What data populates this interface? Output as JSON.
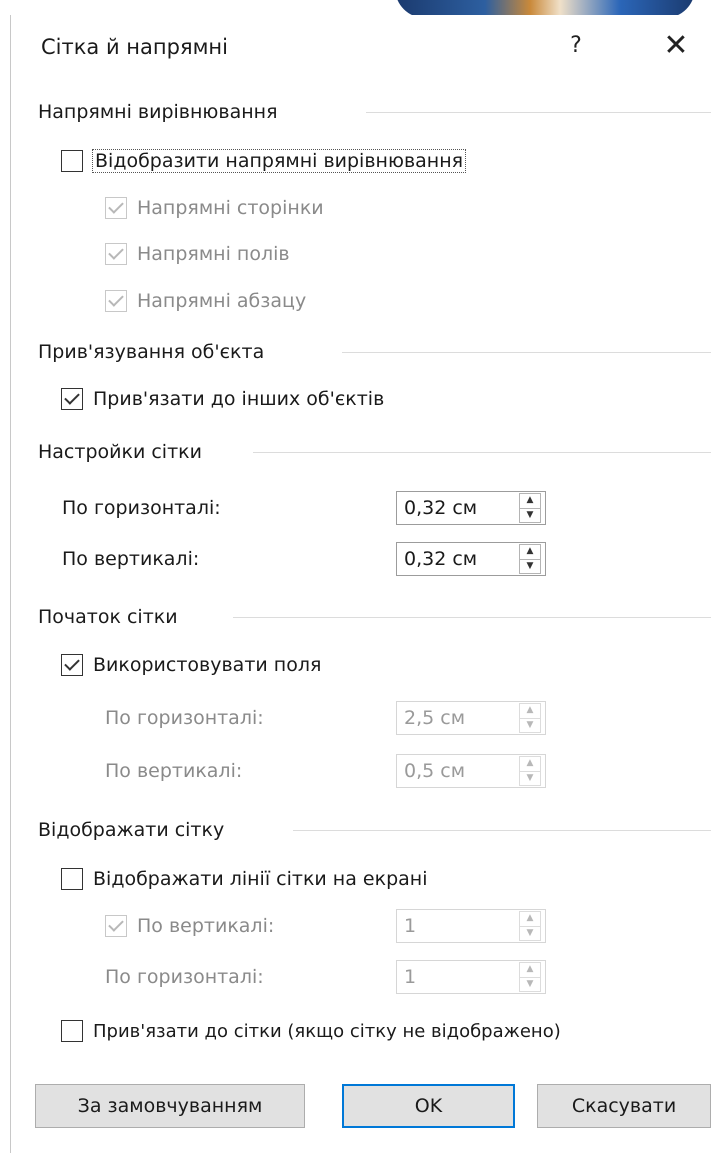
{
  "dialog": {
    "title": "Сітка й напрямні",
    "help_glyph": "?",
    "close_glyph": "✕"
  },
  "alignment_guides": {
    "section_label": "Напрямні вирівнювання",
    "show_label": "Відобразити напрямні вирівнювання",
    "show_checked": false,
    "page_guides": {
      "label": "Напрямні сторінки",
      "checked": true,
      "enabled": false
    },
    "margin_guides": {
      "label": "Напрямні полів",
      "checked": true,
      "enabled": false
    },
    "paragraph_guides": {
      "label": "Напрямні абзацу",
      "checked": true,
      "enabled": false
    }
  },
  "object_snapping": {
    "section_label": "Прив'язування об'єкта",
    "snap_label": "Прив'язати до інших об'єктів",
    "snap_checked": true
  },
  "grid_settings": {
    "section_label": "Настройки сітки",
    "horizontal_label": "По горизонталі:",
    "horizontal_value": "0,32 см",
    "vertical_label": "По вертикалі:",
    "vertical_value": "0,32 см"
  },
  "grid_origin": {
    "section_label": "Початок сітки",
    "use_margins_label": "Використовувати поля",
    "use_margins_checked": true,
    "horizontal_label": "По горизонталі:",
    "horizontal_value": "2,5 см",
    "vertical_label": "По вертикалі:",
    "vertical_value": "0,5 см"
  },
  "show_grid": {
    "section_label": "Відображати сітку",
    "display_lines_label": "Відображати лінії сітки на екрані",
    "display_lines_checked": false,
    "vertical_label": "По вертикалі:",
    "vertical_checked": true,
    "vertical_value": "1",
    "horizontal_label": "По горизонталі:",
    "horizontal_value": "1",
    "snap_to_grid_label": "Прив'язати до сітки (якщо сітку не відображено)",
    "snap_to_grid_checked": false
  },
  "buttons": {
    "default_label": "За замовчуванням",
    "ok_label": "OK",
    "cancel_label": "Скасувати"
  },
  "spinner_glyphs": {
    "up": "▲",
    "down": "▼"
  }
}
